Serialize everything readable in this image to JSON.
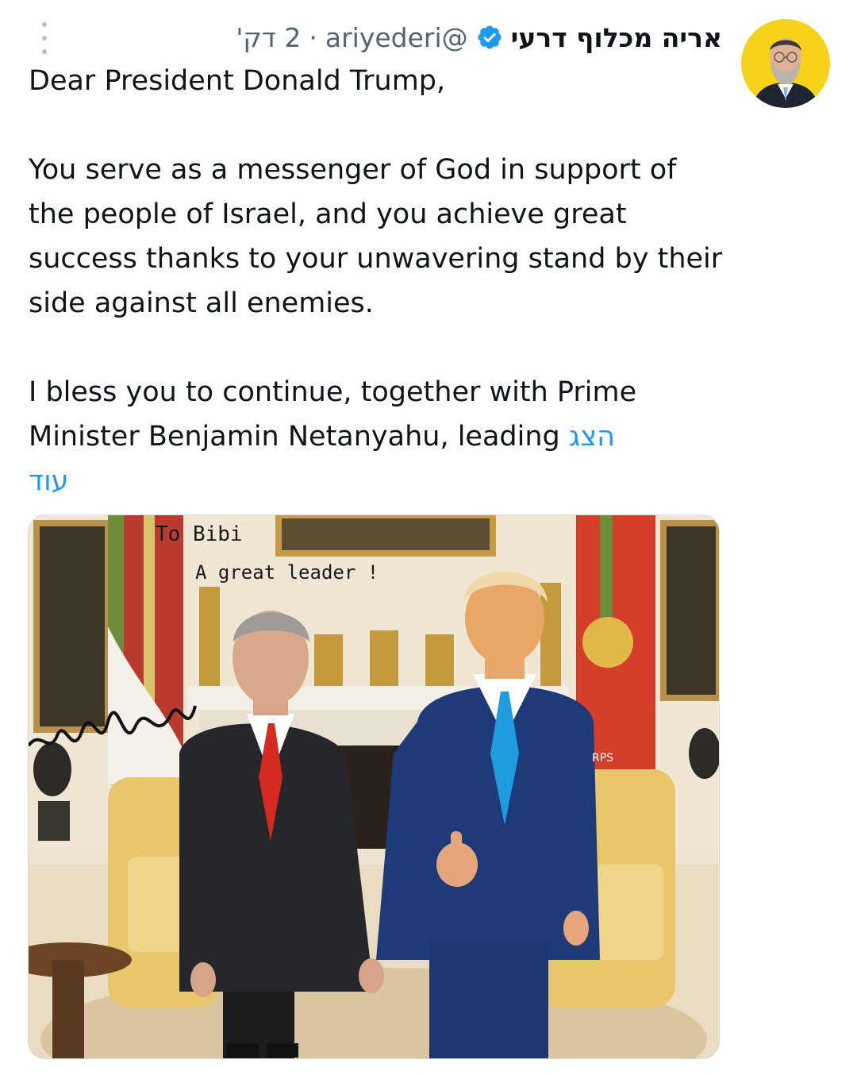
{
  "author": {
    "display_name": "אריה מכלוף דרעי",
    "handle": "@ariyederi",
    "separator": "·",
    "timestamp": "2 דק'",
    "verified_icon": "verified-badge-icon",
    "avatar_color": "#f6d21a"
  },
  "menu": {
    "icon": "more-vertical-icon"
  },
  "tweet": {
    "lines": [
      "Dear President Donald Trump,",
      "You serve as a messenger of God in support of the people of Israel, and you achieve great success thanks to your unwavering stand by their side against all enemies.",
      "I bless you to continue, together with Prime Minister Benjamin Netanyahu, leading"
    ],
    "show_more_1": "הצג",
    "show_more_2": "עוד"
  },
  "photo": {
    "inscription_line1": "To Bibi",
    "inscription_line2": "A great leader !",
    "flag_text": "RPS"
  },
  "colors": {
    "link": "#1d9bf0",
    "muted": "#536471",
    "verified": "#1d9bf0"
  }
}
